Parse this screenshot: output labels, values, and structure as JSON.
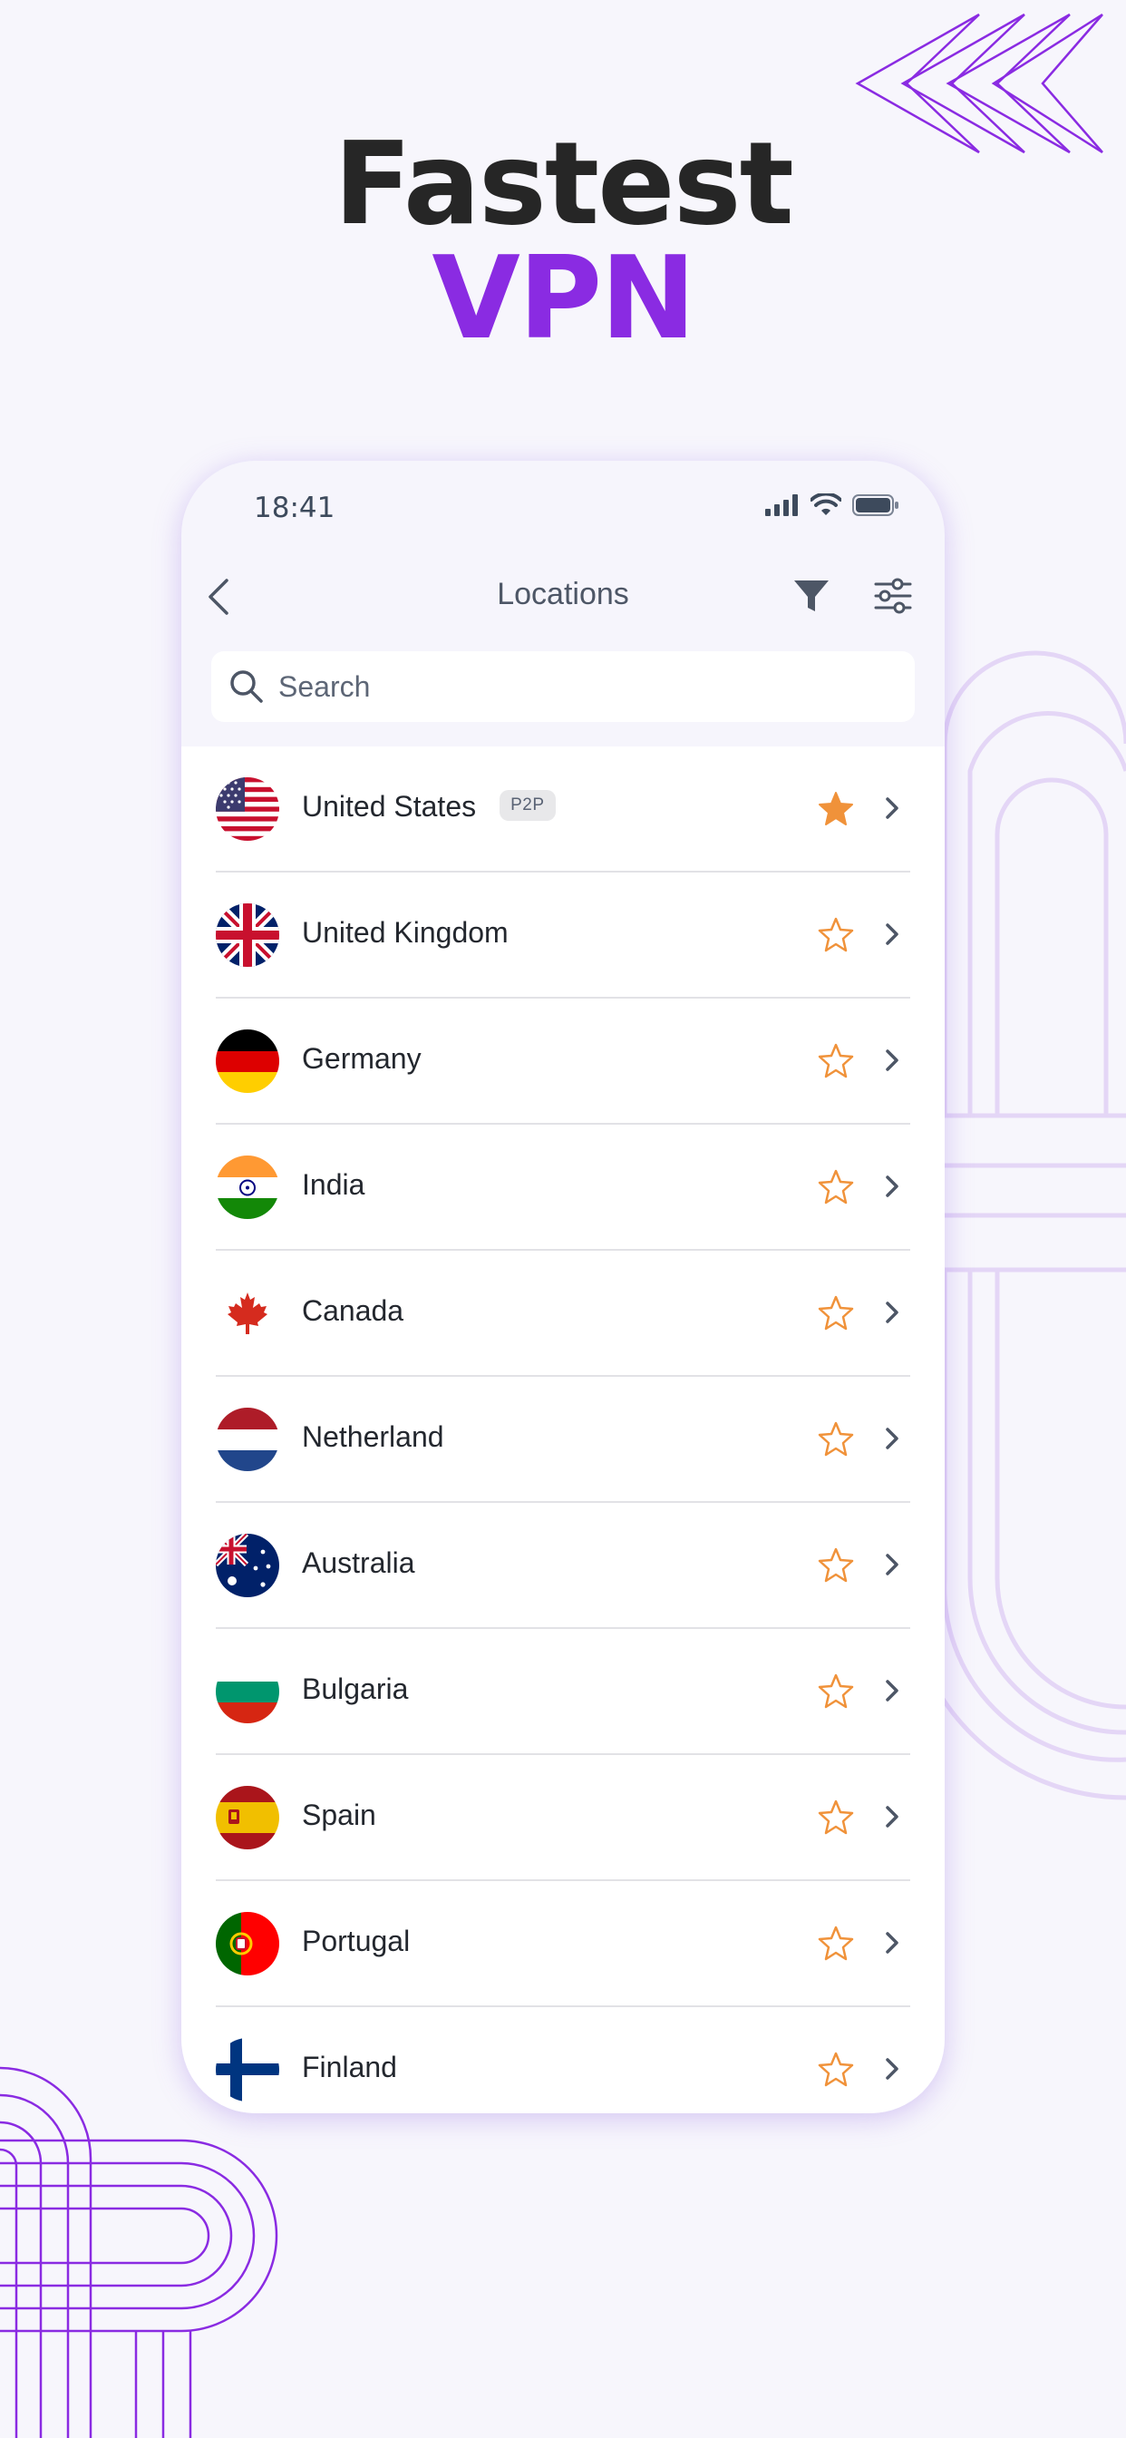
{
  "headline": {
    "line1": "Fastest",
    "line2": "VPN"
  },
  "colors": {
    "accent": "#8a2be2",
    "star": "#f0923a",
    "text": "#23272e",
    "muted": "#4d5666"
  },
  "status": {
    "time": "18:41",
    "icons": [
      "signal-icon",
      "wifi-icon",
      "battery-icon"
    ]
  },
  "nav": {
    "title": "Locations",
    "back_icon": "back-chevron-icon",
    "filter_icon": "filter-icon",
    "adjust_icon": "sliders-icon"
  },
  "search": {
    "placeholder": "Search",
    "icon": "search-icon"
  },
  "locations": [
    {
      "name": "United States",
      "flag": "us-flag-icon",
      "badge": "P2P",
      "favorite": true
    },
    {
      "name": "United Kingdom",
      "flag": "uk-flag-icon",
      "favorite": false
    },
    {
      "name": "Germany",
      "flag": "de-flag-icon",
      "favorite": false
    },
    {
      "name": "India",
      "flag": "in-flag-icon",
      "favorite": false
    },
    {
      "name": "Canada",
      "flag": "ca-flag-icon",
      "favorite": false
    },
    {
      "name": "Netherland",
      "flag": "nl-flag-icon",
      "favorite": false
    },
    {
      "name": "Australia",
      "flag": "au-flag-icon",
      "favorite": false
    },
    {
      "name": "Bulgaria",
      "flag": "bg-flag-icon",
      "favorite": false
    },
    {
      "name": "Spain",
      "flag": "es-flag-icon",
      "favorite": false
    },
    {
      "name": "Portugal",
      "flag": "pt-flag-icon",
      "favorite": false
    },
    {
      "name": "Finland",
      "flag": "fi-flag-icon",
      "favorite": false
    }
  ]
}
